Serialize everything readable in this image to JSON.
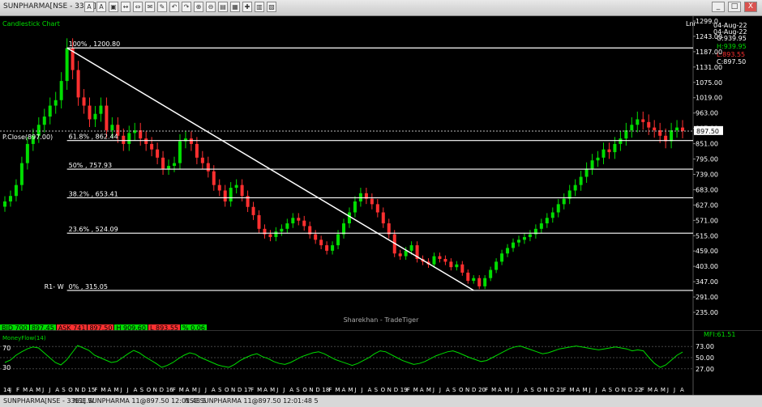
{
  "window": {
    "title": "SUNPHARMA[NSE - 3351] W",
    "tools": [
      "A",
      "A",
      "▣",
      "↔",
      "⇔",
      "✉",
      "✎",
      "↶",
      "↷",
      "⊕",
      "⊖",
      "▤",
      "▦",
      "✚",
      "▥",
      "▧"
    ],
    "controls": [
      "_",
      "□",
      "X"
    ]
  },
  "chart_label": "Candlestick Chart",
  "scale_label": "Lnr",
  "watermark": "Sharekhan - TradeTiger",
  "pclose_label": "P.Close(897.00)",
  "ohlc": {
    "date1": "04-Aug-22",
    "date2": "04-Aug-22",
    "open": "O:939.95",
    "high": "H:939.95",
    "low": "L:893.55",
    "close": "C:897.50"
  },
  "price_tag": "897.50",
  "quote": [
    {
      "label": "BID",
      "value": "700",
      "color": "#00dd00"
    },
    {
      "label": "",
      "value": "897.45",
      "color": "#00dd00"
    },
    {
      "label": "ASK",
      "value": "741",
      "color": "#ff3030"
    },
    {
      "label": "",
      "value": "897.50",
      "color": "#ff3030"
    },
    {
      "label": "H",
      "value": "909.60",
      "color": "#00dd00"
    },
    {
      "label": "L",
      "value": "893.55",
      "color": "#ff3030"
    },
    {
      "label": "%",
      "value": "0.06",
      "color": "#00dd00"
    }
  ],
  "indicator": {
    "name": "MoneyFlow(14)",
    "value_label": "MFI:61.51",
    "left_labels": [
      "70",
      "30"
    ],
    "right_labels": [
      "73.00",
      "50.00",
      "27.00"
    ]
  },
  "status": {
    "tab": "SUNPHARMA[NSE - 3351] W",
    "ticker1": "NSE.SUNPHARMA 11@897.50 12:01:48 5",
    "ticker2": "NSE.SUNPHARMA 11@897.50 12:01:48 5"
  },
  "chart_data": {
    "type": "candlestick",
    "title": "Candlestick Chart",
    "y_axis": {
      "ticks": [
        "1299.0",
        "1243.00",
        "1187.00",
        "1131.00",
        "1075.00",
        "1019.00",
        "963.00",
        "907.00",
        "851.00",
        "795.00",
        "739.00",
        "683.00",
        "627.00",
        "571.00",
        "515.00",
        "459.00",
        "403.00",
        "347.00",
        "291.00",
        "235.00"
      ],
      "min": 235,
      "max": 1299
    },
    "x_axis": {
      "labels": [
        "14",
        "J",
        "F",
        "M",
        "A",
        "M",
        "J",
        "J",
        "A",
        "S",
        "O",
        "N",
        "D",
        "15",
        "F",
        "M",
        "A",
        "M",
        "J",
        "J",
        "A",
        "S",
        "O",
        "N",
        "D",
        "16",
        "F",
        "M",
        "A",
        "M",
        "J",
        "J",
        "A",
        "S",
        "O",
        "N",
        "D",
        "17",
        "F",
        "M",
        "A",
        "M",
        "J",
        "J",
        "A",
        "S",
        "O",
        "N",
        "D",
        "18",
        "F",
        "M",
        "A",
        "M",
        "J",
        "J",
        "A",
        "S",
        "O",
        "N",
        "D",
        "19",
        "F",
        "M",
        "A",
        "M",
        "J",
        "J",
        "A",
        "S",
        "O",
        "N",
        "D",
        "20",
        "F",
        "M",
        "A",
        "M",
        "J",
        "J",
        "A",
        "S",
        "O",
        "N",
        "D",
        "21",
        "F",
        "M",
        "A",
        "M",
        "J",
        "J",
        "A",
        "S",
        "O",
        "N",
        "D",
        "22",
        "F",
        "M",
        "A",
        "M",
        "J",
        "J",
        "A"
      ]
    },
    "close_series": [
      640,
      660,
      700,
      780,
      850,
      880,
      920,
      950,
      990,
      1010,
      1080,
      1200,
      1120,
      1020,
      990,
      940,
      960,
      990,
      900,
      920,
      880,
      850,
      890,
      900,
      870,
      850,
      830,
      800,
      760,
      770,
      780,
      860,
      870,
      850,
      800,
      780,
      750,
      700,
      680,
      640,
      690,
      700,
      660,
      620,
      590,
      540,
      520,
      510,
      530,
      540,
      560,
      580,
      570,
      550,
      520,
      500,
      480,
      460,
      480,
      520,
      560,
      600,
      640,
      670,
      650,
      630,
      600,
      560,
      520,
      450,
      440,
      460,
      480,
      430,
      420,
      410,
      440,
      430,
      420,
      400,
      410,
      380,
      350,
      360,
      330,
      360,
      390,
      420,
      450,
      470,
      490,
      500,
      510,
      520,
      540,
      560,
      580,
      600,
      630,
      650,
      680,
      700,
      730,
      760,
      790,
      800,
      830,
      820,
      850,
      870,
      900,
      920,
      940,
      930,
      910,
      900,
      880,
      860,
      900,
      910,
      897.5
    ],
    "series": [
      {
        "name": "MoneyFlow(14)",
        "values": [
          40,
          45,
          55,
          62,
          68,
          72,
          70,
          60,
          50,
          40,
          35,
          45,
          60,
          75,
          70,
          65,
          55,
          50,
          45,
          40,
          42,
          50,
          58,
          65,
          60,
          52,
          45,
          38,
          30,
          34,
          40,
          48,
          55,
          60,
          57,
          50,
          45,
          40,
          35,
          32,
          30,
          36,
          44,
          50,
          55,
          58,
          52,
          48,
          42,
          38,
          36,
          40,
          46,
          52,
          56,
          60,
          62,
          58,
          52,
          46,
          42,
          38,
          34,
          38,
          44,
          50,
          58,
          64,
          62,
          56,
          50,
          44,
          40,
          36,
          38,
          42,
          48,
          54,
          58,
          62,
          64,
          60,
          55,
          50,
          46,
          42,
          44,
          50,
          56,
          62,
          68,
          72,
          74,
          70,
          66,
          62,
          58,
          60,
          64,
          68,
          70,
          72,
          74,
          72,
          70,
          68,
          66,
          68,
          70,
          72,
          70,
          68,
          64,
          66,
          64,
          50,
          38,
          30,
          35,
          45,
          55,
          61.51
        ]
      }
    ],
    "fibonacci": [
      {
        "level": "100%",
        "value": 1200.8
      },
      {
        "level": "61.8%",
        "value": 862.44
      },
      {
        "level": "50%",
        "value": 757.93
      },
      {
        "level": "38.2%",
        "value": 653.41
      },
      {
        "level": "23.6%",
        "value": 524.09
      },
      {
        "level": "0%",
        "value": 315.05
      }
    ],
    "fib_label": "R1- W",
    "trendline": {
      "from": 1200.8,
      "to": 315.05
    },
    "prev_close": 897.0,
    "last_price": 897.5
  }
}
